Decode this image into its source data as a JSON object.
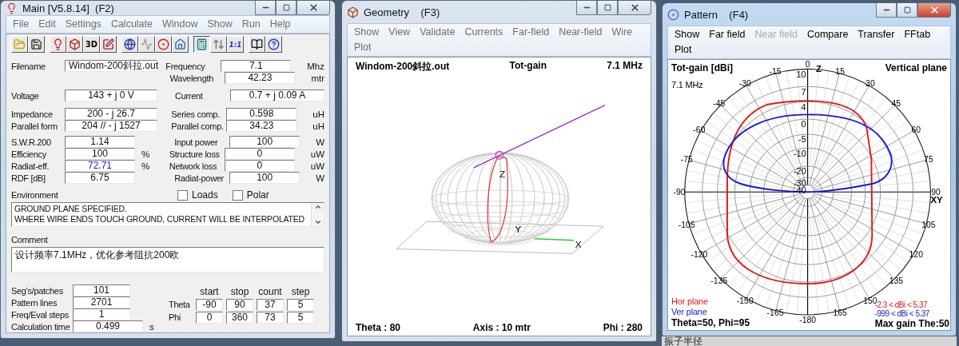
{
  "main_window": {
    "title": "Main [V5.8.14]  (F2)",
    "active": false,
    "menu": [
      {
        "label": "File",
        "disabled": false
      },
      {
        "label": "Edit",
        "disabled": false
      },
      {
        "label": "Settings",
        "disabled": false
      },
      {
        "label": "Calculate",
        "disabled": false
      },
      {
        "label": "Window",
        "disabled": false
      },
      {
        "label": "Show",
        "disabled": false
      },
      {
        "label": "Run",
        "disabled": false
      },
      {
        "label": "Help",
        "disabled": false
      }
    ],
    "toolbar": [
      [
        {
          "kind": "folder",
          "selected": false
        },
        {
          "kind": "disk",
          "selected": false
        }
      ],
      [
        {
          "kind": "bulb",
          "selected": false
        },
        {
          "kind": "cube",
          "selected": false
        },
        {
          "kind": "text",
          "label": "3D",
          "selected": false
        },
        {
          "kind": "pencil",
          "selected": false
        }
      ],
      [
        {
          "kind": "globe",
          "selected": false
        },
        {
          "kind": "wave",
          "selected": false
        },
        {
          "kind": "ball",
          "selected": false
        },
        {
          "kind": "house",
          "selected": false
        }
      ],
      [
        {
          "kind": "calculator",
          "selected": true
        },
        {
          "kind": "arrows",
          "selected": false
        },
        {
          "kind": "text",
          "label": "1:1",
          "selected": false
        }
      ],
      [
        {
          "kind": "book",
          "selected": false
        },
        {
          "kind": "help",
          "selected": false
        }
      ]
    ],
    "sections": [
      [
        {
          "left": {
            "label": "Filename",
            "value": "Windom-200斜拉.out",
            "emphasized": false
          },
          "right": {
            "label": "Frequency",
            "value": "7.1",
            "unit": "Mhz"
          }
        },
        {
          "right": {
            "label": "Wavelength",
            "value": "42.23",
            "unit": "mtr"
          }
        }
      ],
      [
        {
          "left": {
            "label": "Voltage",
            "value": "143 + j 0 V",
            "emphasized": false
          },
          "right": {
            "label": "Current",
            "value": "0.7 + j 0.09 A"
          }
        }
      ],
      [
        {
          "left": {
            "label": "Impedance",
            "value": "200 - j 26.7",
            "emphasized": false
          },
          "right": {
            "label": "Series comp.",
            "value": "0.598",
            "unit": "uH"
          }
        },
        {
          "left": {
            "label": "Parallel form",
            "value": "204 // - j 1527",
            "emphasized": false
          },
          "right": {
            "label": "Parallel comp.",
            "value": "34.23",
            "unit": "uH"
          }
        }
      ],
      [
        {
          "left": {
            "label": "S.W.R.200",
            "value": "1.14",
            "emphasized": false
          },
          "right": {
            "label": "Input power",
            "value": "100",
            "unit": "W"
          }
        },
        {
          "left": {
            "label": "Efficiency",
            "value": "100",
            "unit": "%",
            "emphasized": false
          },
          "right": {
            "label": "Structure loss",
            "value": "0",
            "unit": "uW"
          }
        },
        {
          "left": {
            "label": "Radiat-eff.",
            "value": "72.71",
            "unit": "%",
            "emphasized": true
          },
          "right": {
            "label": "Network loss",
            "value": "0",
            "unit": "uW"
          }
        },
        {
          "left": {
            "label": "RDF [dB]",
            "value": "6.75",
            "emphasized": false
          },
          "right": {
            "label": "Radiat-power",
            "value": "100",
            "unit": "W"
          }
        }
      ]
    ],
    "environment": {
      "label": "Environment",
      "lines": [
        "GROUND PLANE SPECIFIED.",
        "WHERE WIRE ENDS TOUCH GROUND, CURRENT WILL BE INTERPOLATED"
      ]
    },
    "checkboxes": [
      {
        "label": "Loads",
        "checked": false
      },
      {
        "label": "Polar",
        "checked": false
      }
    ],
    "comment": {
      "label": "Comment",
      "value": "设计频率7.1MHz，优化参考阻抗200欧"
    },
    "stats": [
      {
        "label": "Seg's/patches",
        "value": "101"
      },
      {
        "label": "Pattern lines",
        "value": "2701"
      },
      {
        "label": "Freq/Eval steps",
        "value": "1"
      },
      {
        "label": "Calculation time",
        "value": "0.499",
        "unit": "s"
      }
    ],
    "ranges": {
      "columns": [
        "start",
        "stop",
        "count",
        "step"
      ],
      "rows": [
        {
          "label": "Theta",
          "values": [
            "-90",
            "90",
            "37",
            "5"
          ]
        },
        {
          "label": "Phi",
          "values": [
            "0",
            "360",
            "73",
            "5"
          ]
        }
      ]
    }
  },
  "geometry_window": {
    "title": "Geometry    (F3)",
    "active": false,
    "menu": [
      {
        "label": "Show",
        "disabled": false
      },
      {
        "label": "View",
        "disabled": false
      },
      {
        "label": "Validate",
        "disabled": false
      },
      {
        "label": "Currents",
        "disabled": false
      },
      {
        "label": "Far-field",
        "disabled": false
      },
      {
        "label": "Near-field",
        "disabled": false
      },
      {
        "label": "Wire",
        "disabled": false
      },
      {
        "label": "Plot",
        "disabled": false
      }
    ],
    "header": [
      "Windom-200斜拉.out",
      "Tot-gain",
      "7.1 MHz"
    ],
    "axis_labels": [
      "Z",
      "Y",
      "X"
    ],
    "footer": [
      "Theta : 80",
      "Axis : 10 mtr",
      "Phi : 280"
    ]
  },
  "pattern_window": {
    "title": "Pattern    (F4)",
    "active": true,
    "menu": [
      {
        "label": "Show",
        "disabled": false
      },
      {
        "label": "Far field",
        "disabled": false
      },
      {
        "label": "Near field",
        "disabled": true
      },
      {
        "label": "Compare",
        "disabled": false
      },
      {
        "label": "Transfer",
        "disabled": false
      },
      {
        "label": "FFtab",
        "disabled": false
      },
      {
        "label": "Plot",
        "disabled": false
      }
    ],
    "plot": {
      "title": "Tot-gain [dBi]",
      "plane": "Vertical plane",
      "frequency": "7.1 MHz",
      "ring_labels": [
        "10",
        "7",
        "4",
        "0",
        "-5",
        "-10",
        "-20",
        "-30",
        "-40"
      ],
      "angle_labels": [
        "0",
        "15",
        "30",
        "45",
        "60",
        "75",
        "90",
        "105",
        "120",
        "135",
        "150",
        "165",
        "-180",
        "-165",
        "-150",
        "-135",
        "-120",
        "-105",
        "-90",
        "-75",
        "-60",
        "-45",
        "-30",
        "-15"
      ],
      "axis_labels": [
        "Z",
        "XY"
      ],
      "series": [
        {
          "name": "Hor plane",
          "color": "#e01818",
          "range": "-2.3 < dBi < 5.37"
        },
        {
          "name": "Ver plane",
          "color": "#1818d8",
          "range": "-999 < dBi < 5.37"
        }
      ],
      "cursor": "Theta=50, Phi=95",
      "max_gain": "Max gain The:50"
    }
  },
  "background_text": "振子半径"
}
